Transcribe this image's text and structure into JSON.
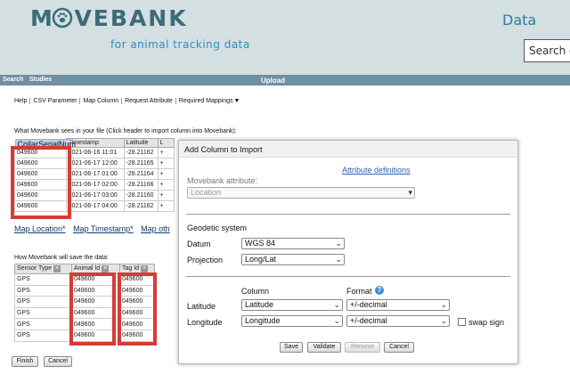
{
  "header": {
    "logo_text": "MOVEBANK",
    "tagline": "for animal tracking data",
    "data_label": "Data",
    "search_placeholder": "Search o"
  },
  "navbar": {
    "search": "Search",
    "studies": "Studies",
    "upload": "Upload"
  },
  "menu": [
    "Help",
    "CSV Parameter",
    "Map Column",
    "Request Attribute",
    "Required Mappings"
  ],
  "instruct_top": "What Movebank sees in your file (Click header to import column into Movebank):",
  "file_table": {
    "headers": [
      "CollarSerialNum",
      "Timestamp",
      "Latitude",
      "L"
    ],
    "rows": [
      [
        "049600",
        "2021-06-16 11:01",
        "-28.21162",
        "+"
      ],
      [
        "049600",
        "2021-06-17 12:00",
        "-28.21165",
        "+"
      ],
      [
        "049600",
        "2021-06-17 01:00",
        "-28.21164",
        "+"
      ],
      [
        "049600",
        "2021-06-17 02:00",
        "-28.21166",
        "+"
      ],
      [
        "049600",
        "2021-06-17 03:00",
        "-28.21160",
        "+"
      ],
      [
        "049600",
        "2021-06-17 04:00",
        "-28.21162",
        "+"
      ]
    ]
  },
  "map_links": [
    "Map Location*",
    "Map Timestamp*",
    "Map oth"
  ],
  "instruct_bottom": "How Movebank will save the data:",
  "save_table": {
    "headers": [
      "Sensor Type",
      "Animal Id",
      "Tag Id"
    ],
    "rows": [
      [
        "GPS",
        "049600",
        "049600"
      ],
      [
        "GPS",
        "049600",
        "049600"
      ],
      [
        "GPS",
        "049600",
        "049600"
      ],
      [
        "GPS",
        "049600",
        "049600"
      ],
      [
        "GPS",
        "049600",
        "049600"
      ],
      [
        "GPS",
        "049600",
        "049600"
      ]
    ]
  },
  "buttons": {
    "finish": "Finish",
    "cancel": "Cancel"
  },
  "dialog": {
    "title": "Add Column to Import",
    "attr_link": "Attribute definitions",
    "attr_label": "Movebank attribute:",
    "attr_value": "Location",
    "geodetic": "Geodetic system",
    "datum_label": "Datum",
    "datum_value": "WGS 84",
    "projection_label": "Projection",
    "projection_value": "Long/Lat",
    "column_header": "Column",
    "format_header": "Format",
    "latitude_label": "Latitude",
    "latitude_col": "Latitude",
    "latitude_fmt": "+/-decimal",
    "longitude_label": "Longitude",
    "longitude_col": "Longitude",
    "longitude_fmt": "+/-decimal",
    "swap_sign": "swap sign",
    "save": "Save",
    "validate": "Validate",
    "remove": "Remove",
    "cancel": "Cancel"
  },
  "colors": {
    "header_bg": "#d4dfe1",
    "nav_bg": "#6f8fa2",
    "highlight": "#d63b36",
    "link": "#2f5fb3"
  }
}
